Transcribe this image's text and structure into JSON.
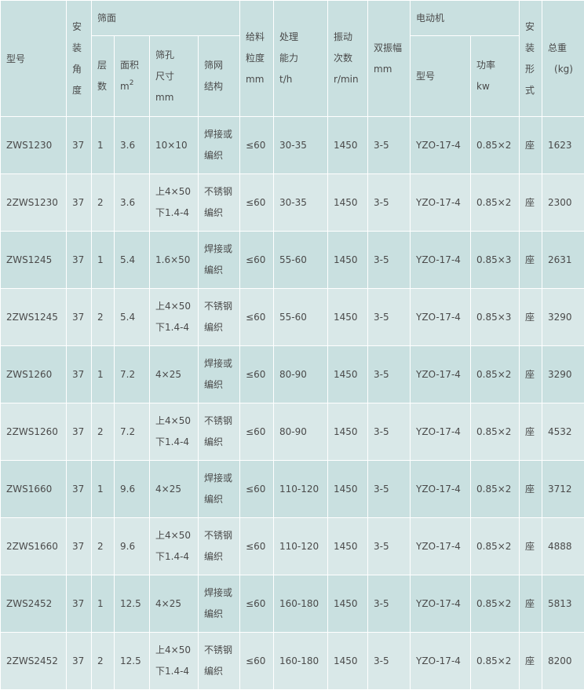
{
  "header": {
    "model": "型号",
    "angle": [
      "安",
      "装",
      "角",
      "度"
    ],
    "screen_surface": "筛面",
    "layers": [
      "层",
      "数"
    ],
    "area": [
      "面积",
      "m"
    ],
    "area_sup": "2",
    "aperture": [
      "筛孔",
      "尺寸",
      "mm"
    ],
    "mesh": [
      "筛网",
      "结构"
    ],
    "feed": [
      "给料",
      "粒度",
      "mm"
    ],
    "capacity": [
      "处理",
      "能力",
      "t/h"
    ],
    "vibration": [
      "振动",
      "次数",
      "r/min"
    ],
    "amplitude": [
      "双振幅",
      "mm"
    ],
    "motor": "电动机",
    "motor_model": "型号",
    "power": [
      "功率",
      "kw"
    ],
    "mount": [
      "安",
      "装",
      "形",
      "式"
    ],
    "weight": [
      "总重",
      "(kg)"
    ]
  },
  "rows": [
    {
      "model": "ZWS1230",
      "angle": "37",
      "layers": "1",
      "area": "3.6",
      "aperture": [
        "10×10"
      ],
      "mesh": [
        "焊接或",
        "编织"
      ],
      "feed": "≤60",
      "capacity": "30-35",
      "vibration": "1450",
      "amplitude": "3-5",
      "motor": "YZO-17-4",
      "power": "0.85×2",
      "mount": "座",
      "weight": "1623"
    },
    {
      "model": "2ZWS1230",
      "angle": "37",
      "layers": "2",
      "area": "3.6",
      "aperture": [
        "上4×50",
        "下1.4-4"
      ],
      "mesh": [
        "不锈钢",
        "编织"
      ],
      "feed": "≤60",
      "capacity": "30-35",
      "vibration": "1450",
      "amplitude": "3-5",
      "motor": "YZO-17-4",
      "power": "0.85×2",
      "mount": "座",
      "weight": "2300"
    },
    {
      "model": "ZWS1245",
      "angle": "37",
      "layers": "1",
      "area": "5.4",
      "aperture": [
        "1.6×50"
      ],
      "mesh": [
        "焊接或",
        "编织"
      ],
      "feed": "≤60",
      "capacity": "55-60",
      "vibration": "1450",
      "amplitude": "3-5",
      "motor": "YZO-17-4",
      "power": "0.85×3",
      "mount": "座",
      "weight": "2631"
    },
    {
      "model": "2ZWS1245",
      "angle": "37",
      "layers": "2",
      "area": "5.4",
      "aperture": [
        "上4×50",
        "下1.4-4"
      ],
      "mesh": [
        "不锈钢",
        "编织"
      ],
      "feed": "≤60",
      "capacity": "55-60",
      "vibration": "1450",
      "amplitude": "3-5",
      "motor": "YZO-17-4",
      "power": "0.85×3",
      "mount": "座",
      "weight": "3290"
    },
    {
      "model": "ZWS1260",
      "angle": "37",
      "layers": "1",
      "area": "7.2",
      "aperture": [
        "4×25"
      ],
      "mesh": [
        "焊接或",
        "编织"
      ],
      "feed": "≤60",
      "capacity": "80-90",
      "vibration": "1450",
      "amplitude": "3-5",
      "motor": "YZO-17-4",
      "power": "0.85×2",
      "mount": "座",
      "weight": "3290"
    },
    {
      "model": "2ZWS1260",
      "angle": "37",
      "layers": "2",
      "area": "7.2",
      "aperture": [
        "上4×50",
        "下1.4-4"
      ],
      "mesh": [
        "不锈钢",
        "编织"
      ],
      "feed": "≤60",
      "capacity": "80-90",
      "vibration": "1450",
      "amplitude": "3-5",
      "motor": "YZO-17-4",
      "power": "0.85×2",
      "mount": "座",
      "weight": "4532"
    },
    {
      "model": "ZWS1660",
      "angle": "37",
      "layers": "1",
      "area": "9.6",
      "aperture": [
        "4×25"
      ],
      "mesh": [
        "焊接或",
        "编织"
      ],
      "feed": "≤60",
      "capacity": "110-120",
      "vibration": "1450",
      "amplitude": "3-5",
      "motor": "YZO-17-4",
      "power": "0.85×2",
      "mount": "座",
      "weight": "3712"
    },
    {
      "model": "2ZWS1660",
      "angle": "37",
      "layers": "2",
      "area": "9.6",
      "aperture": [
        "上4×50",
        "下1.4-4"
      ],
      "mesh": [
        "不锈钢",
        "编织"
      ],
      "feed": "≤60",
      "capacity": "110-120",
      "vibration": "1450",
      "amplitude": "3-5",
      "motor": "YZO-17-4",
      "power": "0.85×2",
      "mount": "座",
      "weight": "4888"
    },
    {
      "model": "ZWS2452",
      "angle": "37",
      "layers": "1",
      "area": "12.5",
      "aperture": [
        "4×25"
      ],
      "mesh": [
        "焊接或",
        "编织"
      ],
      "feed": "≤60",
      "capacity": "160-180",
      "vibration": "1450",
      "amplitude": "3-5",
      "motor": "YZO-17-4",
      "power": "0.85×2",
      "mount": "座",
      "weight": "5813"
    },
    {
      "model": "2ZWS2452",
      "angle": "37",
      "layers": "2",
      "area": "12.5",
      "aperture": [
        "上4×50",
        "下1.4-4"
      ],
      "mesh": [
        "不锈钢",
        "编织"
      ],
      "feed": "≤60",
      "capacity": "160-180",
      "vibration": "1450",
      "amplitude": "3-5",
      "motor": "YZO-17-4",
      "power": "0.85×2",
      "mount": "座",
      "weight": "8200"
    }
  ],
  "colors": {
    "header_bg": "#c9e0e0",
    "row_dark": "#c9e0e0",
    "row_light": "#d9e8e8",
    "text": "#4a4a4a",
    "grid": "#ffffff"
  }
}
